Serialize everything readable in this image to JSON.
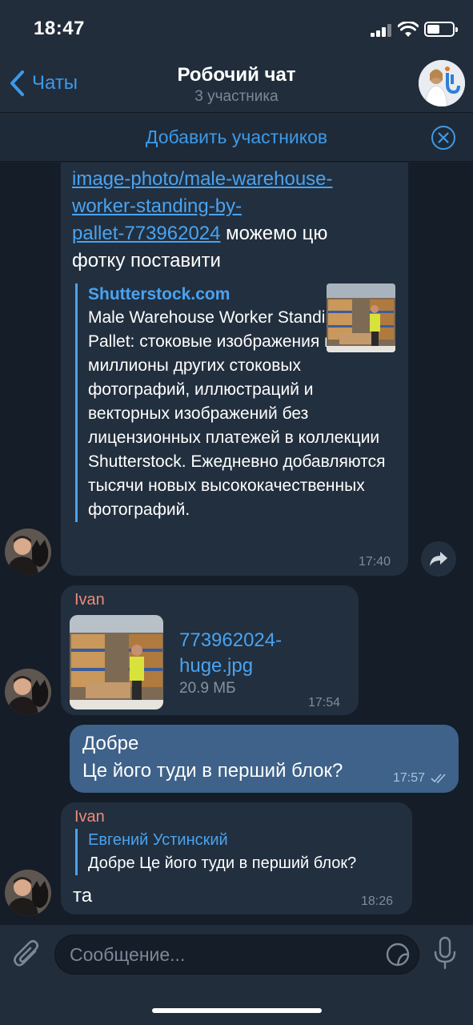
{
  "status_bar": {
    "time": "18:47"
  },
  "nav": {
    "back_label": "Чаты",
    "title": "Робочий чат",
    "subtitle": "3 участника",
    "add_members_label": "Добавить участников"
  },
  "messages": {
    "m1": {
      "link_lines": [
        "image-photo/male-warehouse-",
        "worker-standing-by-",
        "pallet-773962024"
      ],
      "text_after_link": " можемо цю",
      "text_line2": "фотку поставити",
      "preview_site": "Shutterstock.com",
      "preview_desc": "Male Warehouse Worker Standing By Pallet: стоковые изображения в HD и миллионы других стоковых фотографий, иллюстраций и векторных изображений без лицензионных платежей в коллекции Shutterstock. Ежедневно добавляются тысячи новых высококачественных фотографий.",
      "time": "17:40"
    },
    "m2": {
      "sender": "Ivan",
      "file_name_line1": "773962024-",
      "file_name_line2": "huge.jpg",
      "file_size": "20.9 МБ",
      "time": "17:54"
    },
    "m3": {
      "line1": "Добре",
      "line2": "Це його туди в перший блок?",
      "time": "17:57"
    },
    "m4": {
      "sender": "Ivan",
      "reply_name": "Евгений Устинский",
      "reply_text": "Добре Це його туди в перший блок?",
      "text": "та",
      "time": "18:26"
    }
  },
  "input": {
    "placeholder": "Сообщение..."
  },
  "colors": {
    "accent": "#3d9ae8",
    "header_bg": "#222d3b",
    "chat_bg": "#151d29",
    "incoming_bubble": "#222f3e",
    "outgoing_bubble": "#3e6289",
    "sender_name": "#ef8a7a"
  },
  "icons": [
    "chevron-left-icon",
    "close-circle-icon",
    "forward-icon",
    "paperclip-icon",
    "sticker-icon",
    "microphone-icon",
    "double-check-icon"
  ]
}
